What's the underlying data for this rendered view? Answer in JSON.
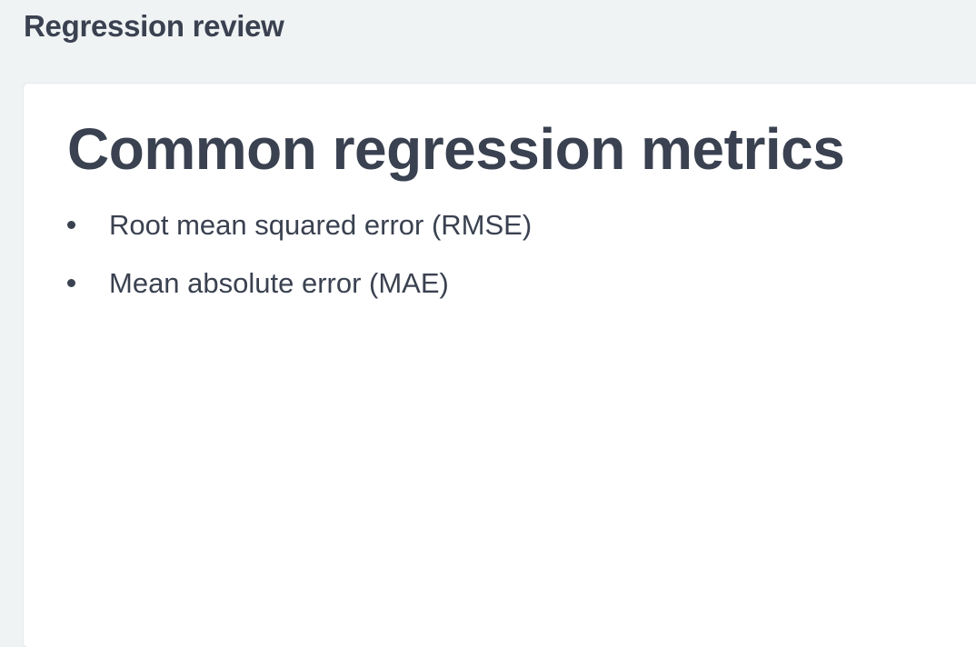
{
  "header": {
    "title": "Regression review"
  },
  "slide": {
    "title": "Common regression metrics",
    "bullets": [
      "Root mean squared error (RMSE)",
      "Mean absolute error (MAE)"
    ]
  },
  "colors": {
    "background": "#f0f3f4",
    "card": "#ffffff",
    "text": "#3a4150"
  }
}
